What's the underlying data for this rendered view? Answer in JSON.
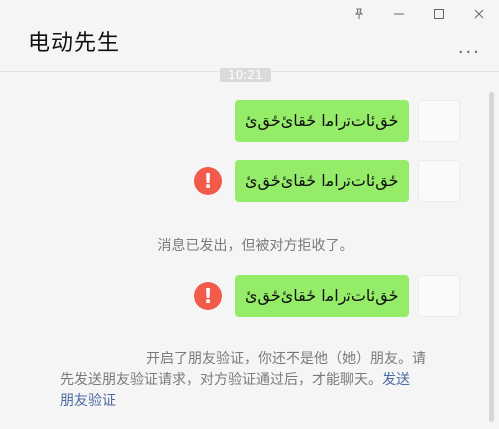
{
  "window": {
    "title": "电动先生",
    "controls": {
      "pin_icon": "pin-icon",
      "minimize_icon": "minimize-icon",
      "maximize_icon": "maximize-icon",
      "close_icon": "close-icon"
    },
    "more_label": "···"
  },
  "chat": {
    "timestamp": "10:21",
    "messages": [
      {
        "text": "ځق‌ئاﺕﺗﺭﺍﻣﺍ ځقائ‌ځق‌ئ"
      },
      {
        "text": "ځق‌ئاﺕﺗﺭﺍﻣﺍ ځقائ‌ځق‌ئ",
        "status": "failed"
      },
      {
        "text": "ځق‌ئاﺕﺗﺭﺍﻣﺍ ځقائ‌ځق‌ئ",
        "status": "failed"
      }
    ],
    "notice": "消息已发出，但被对方拒收了。",
    "friend_verification": {
      "line1": "开启了朋友验证，你还不是他（她）朋友。请",
      "line2_prefix": "先发送朋友验证请求，对方验证通过后，才能聊天。",
      "line2_link": "发送",
      "line3_link": "朋友验证"
    }
  }
}
